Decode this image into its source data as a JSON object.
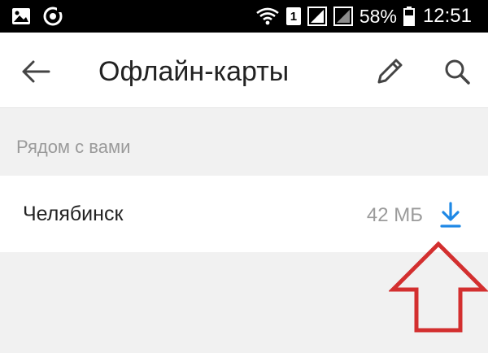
{
  "status_bar": {
    "left_icons": [
      "image-icon",
      "sync-icon"
    ],
    "right_icons": [
      "wifi-icon",
      "sim-1-icon",
      "signal-icon",
      "signal-2-icon"
    ],
    "sim_label": "1",
    "battery_percent": "58%",
    "battery_level": 0.58,
    "time": "12:51"
  },
  "toolbar": {
    "back_icon": "arrow-left-icon",
    "title": "Офлайн-карты",
    "edit_icon": "pencil-icon",
    "search_icon": "search-icon"
  },
  "section": {
    "header": "Рядом с вами"
  },
  "items": [
    {
      "name": "Челябинск",
      "size": "42 МБ",
      "action_icon": "download-icon"
    }
  ],
  "colors": {
    "accent": "#1e88e5",
    "annotation": "#d32f2f",
    "background": "#f1f1f1",
    "surface": "#ffffff",
    "text_primary": "#222222",
    "text_secondary": "#9b9b9b"
  }
}
